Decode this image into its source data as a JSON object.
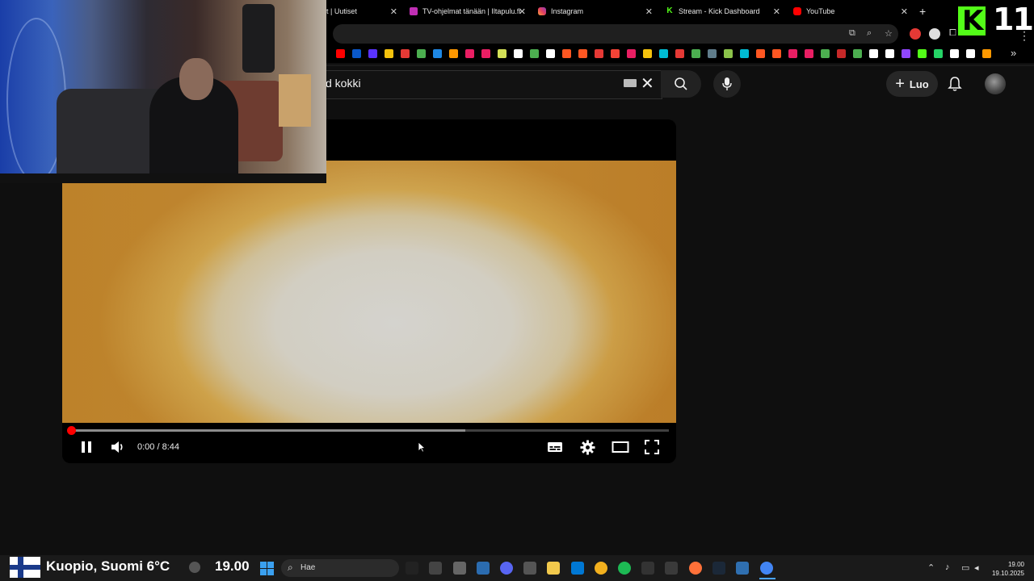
{
  "browser": {
    "tabs": [
      {
        "label": "t | Uutiset",
        "favicon_color": "#000000"
      },
      {
        "label": "TV-ohjelmat tänään | Iltapulu.fi",
        "favicon_color": "#c02fb4"
      },
      {
        "label": "Instagram",
        "favicon_color": "#e4405f"
      },
      {
        "label": "Stream - Kick Dashboard",
        "favicon_color": "#53fc18"
      },
      {
        "label": "YouTube",
        "favicon_color": "#ff0000"
      }
    ],
    "new_tab_label": "+",
    "bookmark_colors": [
      "#ff0000",
      "#0a58ca",
      "#5a33ff",
      "#f4c20d",
      "#e53935",
      "#4caf50",
      "#1e88e5",
      "#ff9800",
      "#e91e63",
      "#e91e63",
      "#d4e157",
      "#ffffff",
      "#4caf50",
      "#ffffff",
      "#ff5722",
      "#ff5722",
      "#e53935",
      "#f44336",
      "#e91e63",
      "#f4c20d",
      "#00bcd4",
      "#e53935",
      "#4caf50",
      "#607d8b",
      "#8bc34a",
      "#00bcd4",
      "#ff5722",
      "#ff5722",
      "#e91e63",
      "#e91e63",
      "#4caf50",
      "#c62828",
      "#4caf50",
      "#ffffff",
      "#ffffff",
      "#9146ff",
      "#53fc18",
      "#25d366",
      "#ffffff",
      "#ffffff",
      "#ff9900"
    ],
    "more_bookmarks": "»"
  },
  "youtube": {
    "search_value": "d kokki",
    "create_label": "Luo"
  },
  "player": {
    "time_current": "0:00",
    "time_separator": "/",
    "time_total": "8:44",
    "progress_fraction": 0.0,
    "buffer_fraction": 0.66
  },
  "overlay": {
    "kick_logo_letter": "K",
    "kick_counter": "11",
    "kick_color": "#53fc18"
  },
  "taskbar": {
    "location": "Kuopio, Suomi",
    "temperature": "6°C",
    "clock_widget": "19.00",
    "search_placeholder": "Hae",
    "tray_time": "19.00",
    "tray_date": "19.10.2025"
  }
}
